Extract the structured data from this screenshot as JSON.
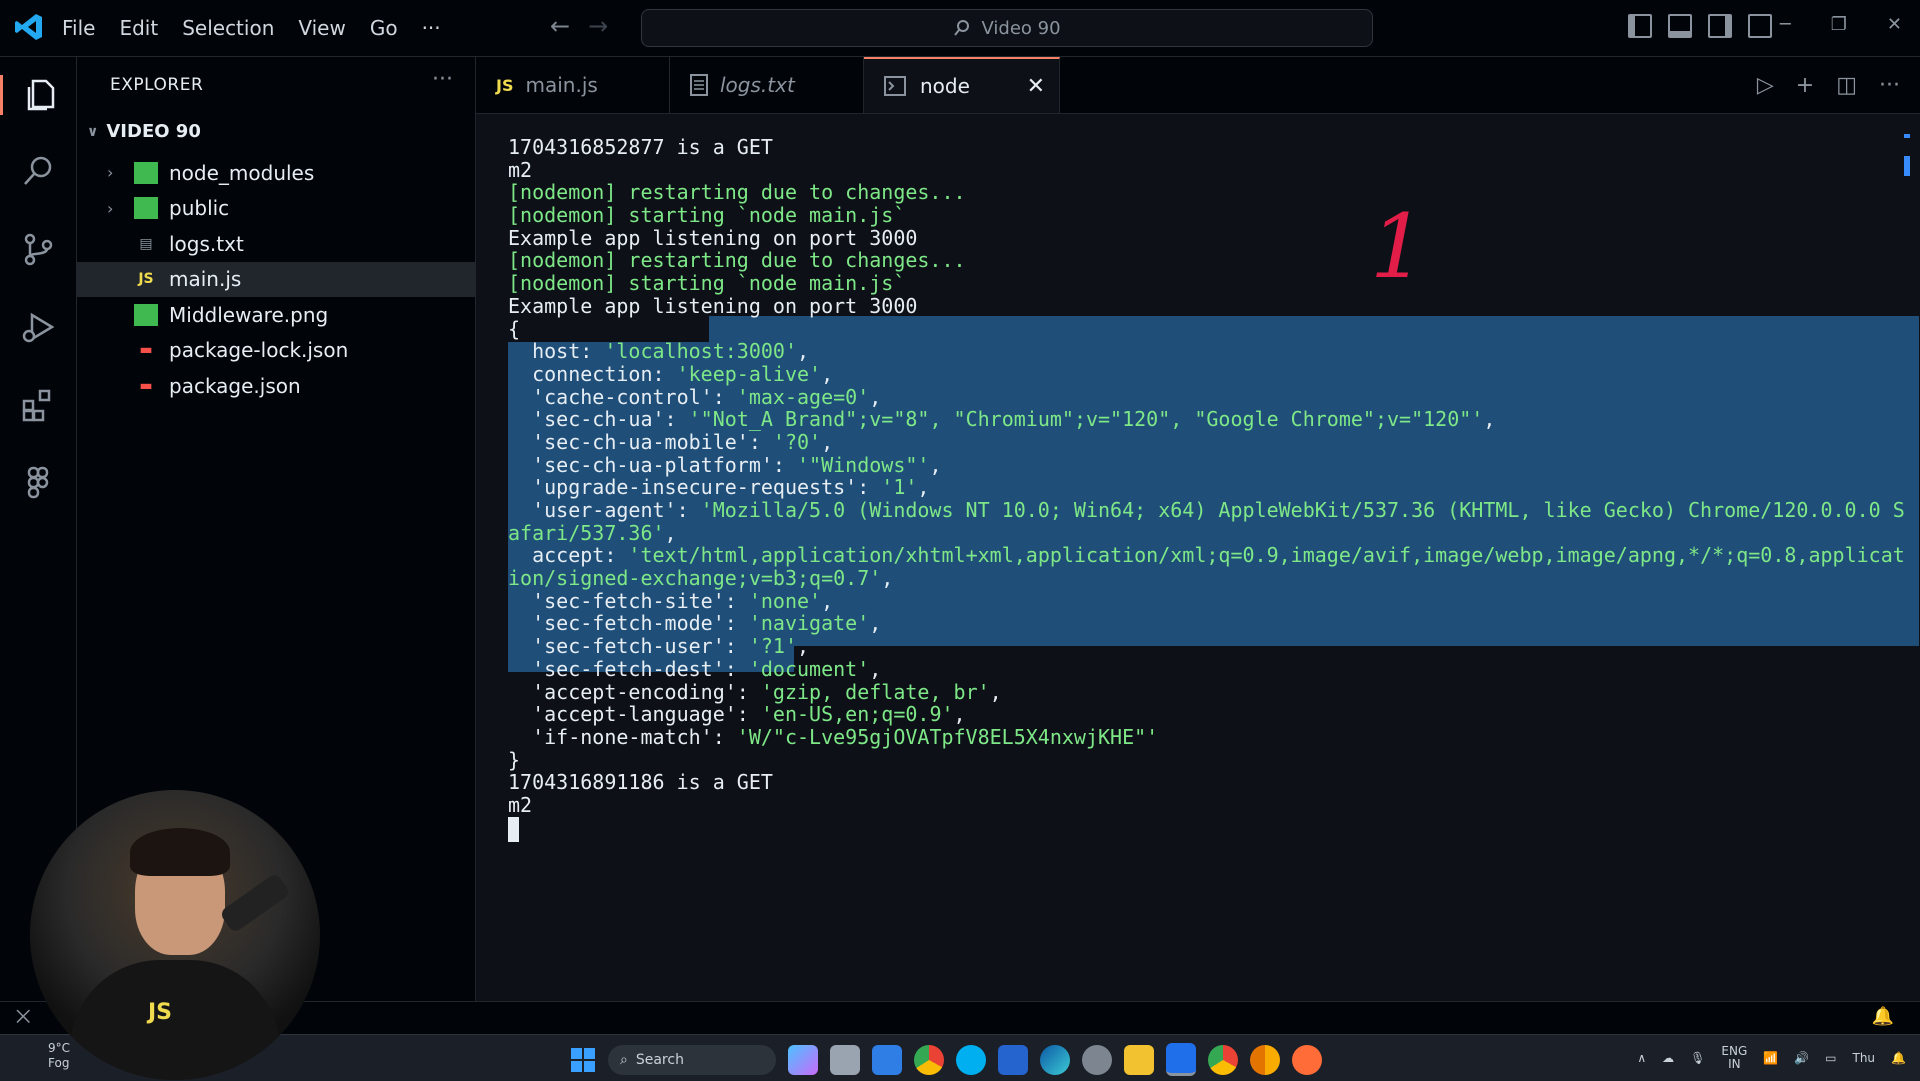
{
  "titlebar": {
    "menu": [
      "File",
      "Edit",
      "Selection",
      "View",
      "Go",
      "···"
    ],
    "search_text": "Video 90",
    "window_controls": [
      "─",
      "❐",
      "✕"
    ]
  },
  "explorer": {
    "title": "EXPLORER",
    "more": "···",
    "folder": "VIDEO 90",
    "items": [
      {
        "name": "node_modules",
        "icon": "folder-icon",
        "expandable": true
      },
      {
        "name": "public",
        "icon": "folder-icon",
        "expandable": true
      },
      {
        "name": "logs.txt",
        "icon": "text-file-icon",
        "expandable": false
      },
      {
        "name": "main.js",
        "icon": "js-file-icon",
        "badge": "JS",
        "expandable": false,
        "selected": true
      },
      {
        "name": "Middleware.png",
        "icon": "image-file-icon",
        "expandable": false
      },
      {
        "name": "package-lock.json",
        "icon": "npm-file-icon",
        "expandable": false
      },
      {
        "name": "package.json",
        "icon": "npm-file-icon",
        "expandable": false
      }
    ]
  },
  "tabs": [
    {
      "label": "main.js",
      "badge": "JS"
    },
    {
      "label": "logs.txt"
    },
    {
      "label": "node",
      "active": true
    }
  ],
  "terminal": {
    "lines": [
      {
        "text": "1704316852877 is a GET",
        "color": "white"
      },
      {
        "text": "m2",
        "color": "white"
      },
      {
        "text": "[nodemon] restarting due to changes...",
        "color": "green"
      },
      {
        "text": "[nodemon] starting `node main.js`",
        "color": "green"
      },
      {
        "text": "Example app listening on port 3000",
        "color": "white"
      },
      {
        "text": "[nodemon] restarting due to changes...",
        "color": "green"
      },
      {
        "text": "[nodemon] starting `node main.js`",
        "color": "green"
      },
      {
        "text": "Example app listening on port 3000",
        "color": "white"
      },
      {
        "text": "{",
        "color": "white"
      },
      {
        "key": "  host: ",
        "val": "'localhost:3000'",
        "tail": ","
      },
      {
        "key": "  connection: ",
        "val": "'keep-alive'",
        "tail": ","
      },
      {
        "key": "  'cache-control': ",
        "val": "'max-age=0'",
        "tail": ","
      },
      {
        "key": "  'sec-ch-ua': ",
        "val": "'\"Not_A Brand\";v=\"8\", \"Chromium\";v=\"120\", \"Google Chrome\";v=\"120\"'",
        "tail": ","
      },
      {
        "key": "  'sec-ch-ua-mobile': ",
        "val": "'?0'",
        "tail": ","
      },
      {
        "key": "  'sec-ch-ua-platform': ",
        "val": "'\"Windows\"'",
        "tail": ","
      },
      {
        "key": "  'upgrade-insecure-requests': ",
        "val": "'1'",
        "tail": ","
      },
      {
        "key": "  'user-agent': ",
        "val": "'Mozilla/5.0 (Windows NT 10.0; Win64; x64) AppleWebKit/537.36 (KHTML, like Gecko) Chrome/120.0.0.0 S",
        "tail": ""
      },
      {
        "key": "",
        "val": "afari/537.36'",
        "tail": ","
      },
      {
        "key": "  accept: ",
        "val": "'text/html,application/xhtml+xml,application/xml;q=0.9,image/avif,image/webp,image/apng,*/*;q=0.8,applicat",
        "tail": ""
      },
      {
        "key": "",
        "val": "ion/signed-exchange;v=b3;q=0.7'",
        "tail": ","
      },
      {
        "key": "  'sec-fetch-site': ",
        "val": "'none'",
        "tail": ","
      },
      {
        "key": "  'sec-fetch-mode': ",
        "val": "'navigate'",
        "tail": ","
      },
      {
        "key": "  'sec-fetch-user': ",
        "val": "'?1'",
        "tail": ","
      },
      {
        "key": "  'sec-fetch-dest': ",
        "val": "'document'",
        "tail": ","
      },
      {
        "key": "  'accept-encoding': ",
        "val": "'gzip, deflate, br'",
        "tail": ","
      },
      {
        "key": "  'accept-language': ",
        "val": "'en-US,en;q=0.9'",
        "tail": ","
      },
      {
        "key": "  'if-none-match': ",
        "val": "'W/\"c-Lve95gjOVATpfV8EL5X4nxwjKHE\"'",
        "tail": ""
      },
      {
        "text": "}",
        "color": "white"
      },
      {
        "text": "1704316891186 is a GET",
        "color": "white"
      },
      {
        "text": "m2",
        "color": "white"
      },
      {
        "cursor": true
      }
    ]
  },
  "annotation": "1",
  "webcam": {
    "shirt_text": "JS"
  },
  "taskbar": {
    "weather_temp": "9°C",
    "weather_desc": "Fog",
    "search_label": "Search",
    "lang": "ENG",
    "region": "IN",
    "day": "Thu"
  },
  "colors": {
    "accent": "#f78166",
    "selection": "#1f4e79",
    "string": "#7ee787",
    "annotation": "#e11d48"
  }
}
